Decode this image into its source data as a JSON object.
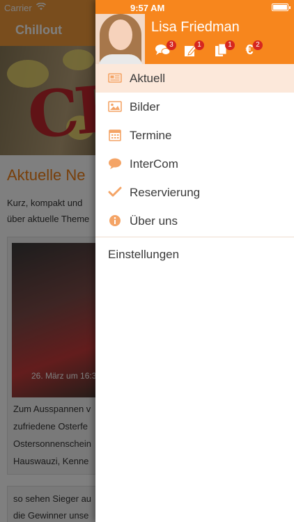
{
  "status": {
    "carrier": "Carrier",
    "time": "9:57 AM"
  },
  "background_app": {
    "nav_title": "Chillout",
    "heading": "Aktuelle Ne",
    "intro_lines": [
      "Kurz, kompakt und",
      "über aktuelle Theme"
    ],
    "card1": {
      "date": "26. März um 16:3",
      "lines": [
        "Zum Ausspannen v",
        "zufriedene Osterfe",
        "Ostersonnenschein",
        "Hauswauzi, Kenne"
      ]
    },
    "card2": {
      "lines": [
        "so sehen Sieger au",
        "die Gewinner unse"
      ]
    }
  },
  "drawer": {
    "user_name": "Lisa Friedman",
    "notifications": [
      {
        "icon": "chat-bubbles-icon",
        "count": "3"
      },
      {
        "icon": "pencil-note-icon",
        "count": "1"
      },
      {
        "icon": "documents-icon",
        "count": "1"
      },
      {
        "icon": "euro-icon",
        "count": "2"
      }
    ],
    "menu": [
      {
        "label": "Aktuell",
        "icon": "newspaper-icon",
        "active": true
      },
      {
        "label": "Bilder",
        "icon": "image-icon",
        "active": false
      },
      {
        "label": "Termine",
        "icon": "calendar-icon",
        "active": false
      },
      {
        "label": "InterCom",
        "icon": "speech-bubble-icon",
        "active": false
      },
      {
        "label": "Reservierung",
        "icon": "checkmark-icon",
        "active": false
      },
      {
        "label": "Über uns",
        "icon": "info-icon",
        "active": false
      }
    ],
    "settings_label": "Einstellungen"
  },
  "colors": {
    "accent": "#f7861d",
    "active_row": "#fce8da",
    "icon": "#f4a466",
    "badge": "#d6261f"
  }
}
